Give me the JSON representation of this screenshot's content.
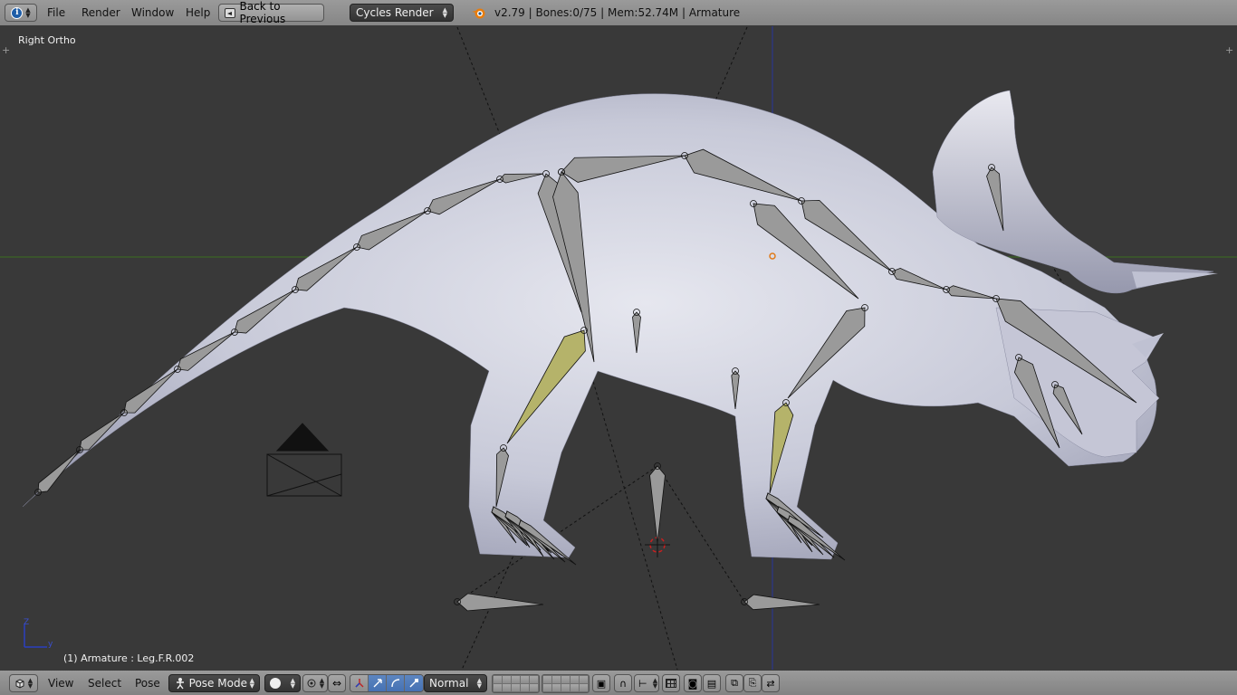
{
  "header": {
    "menus": [
      "File",
      "Render",
      "Window",
      "Help"
    ],
    "back_button": "Back to Previous",
    "render_engine": "Cycles Render",
    "stats": "v2.79 | Bones:0/75 | Mem:52.74M | Armature"
  },
  "viewport": {
    "view_label": "Right Ortho",
    "object_label": "(1) Armature : Leg.F.R.002",
    "axes": {
      "z": "Z",
      "y": "y"
    }
  },
  "footer": {
    "menus": [
      "View",
      "Select",
      "Pose"
    ],
    "mode": "Pose Mode",
    "pivot": "Normal"
  },
  "colors": {
    "header_bg": "#8e8e8e",
    "viewport_bg": "#393939",
    "mesh": "#c9cbd8",
    "bone": "#9a9a9a",
    "active_bone": "#b5b36a",
    "axis_x": "#3a6e1e",
    "axis_y": "#26359a"
  },
  "icons": {
    "editor_type": "info-icon",
    "engine_logo": "blender-logo-icon",
    "footer_editor": "3d-view-icon",
    "shading": "solid-shading-icon",
    "pivot_point": "pivot-point-icon",
    "manipulator": "manipulator-icon",
    "translate": "translate-icon",
    "rotate": "rotate-icon",
    "scale": "scale-icon",
    "layers": "layers-grid",
    "lock": "lock-camera-icon",
    "snap": "snap-magnet-icon",
    "render": "render-camera-icon",
    "copy_pose": "copy-pose-icon",
    "paste_pose": "paste-pose-icon"
  }
}
